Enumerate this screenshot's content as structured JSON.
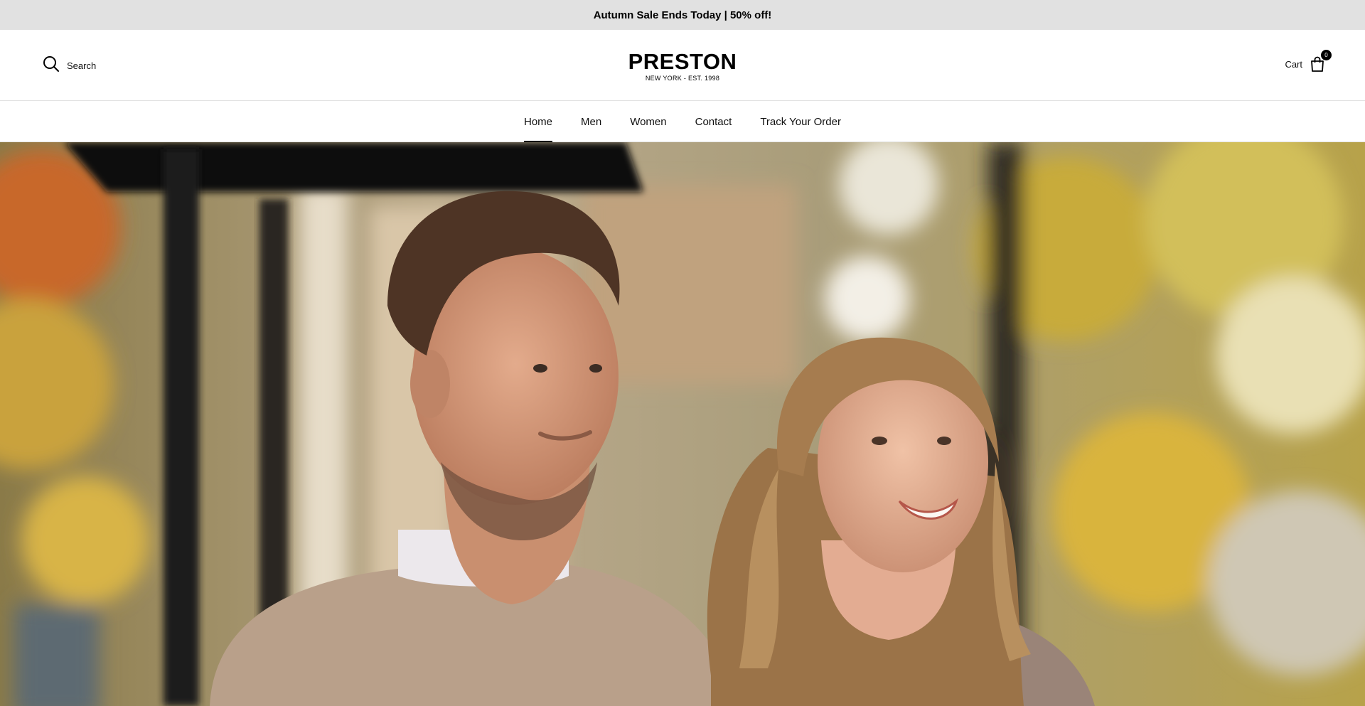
{
  "announcement": {
    "text": "Autumn Sale Ends Today | 50% off!"
  },
  "header": {
    "search_label": "Search",
    "search_icon": "search-icon",
    "logo_name": "PRESTON",
    "logo_tagline": "NEW YORK - EST. 1998",
    "cart_label": "Cart",
    "cart_icon": "shopping-bag-icon",
    "cart_count": "0"
  },
  "nav": {
    "items": [
      {
        "label": "Home",
        "active": true
      },
      {
        "label": "Men",
        "active": false
      },
      {
        "label": "Women",
        "active": false
      },
      {
        "label": "Contact",
        "active": false
      },
      {
        "label": "Track Your Order",
        "active": false
      }
    ]
  },
  "hero": {
    "image": "couple-walking-autumn-street-photo"
  },
  "colors": {
    "announcement_bg": "#e1e1e1",
    "text": "#000000",
    "accent": "#000000"
  }
}
